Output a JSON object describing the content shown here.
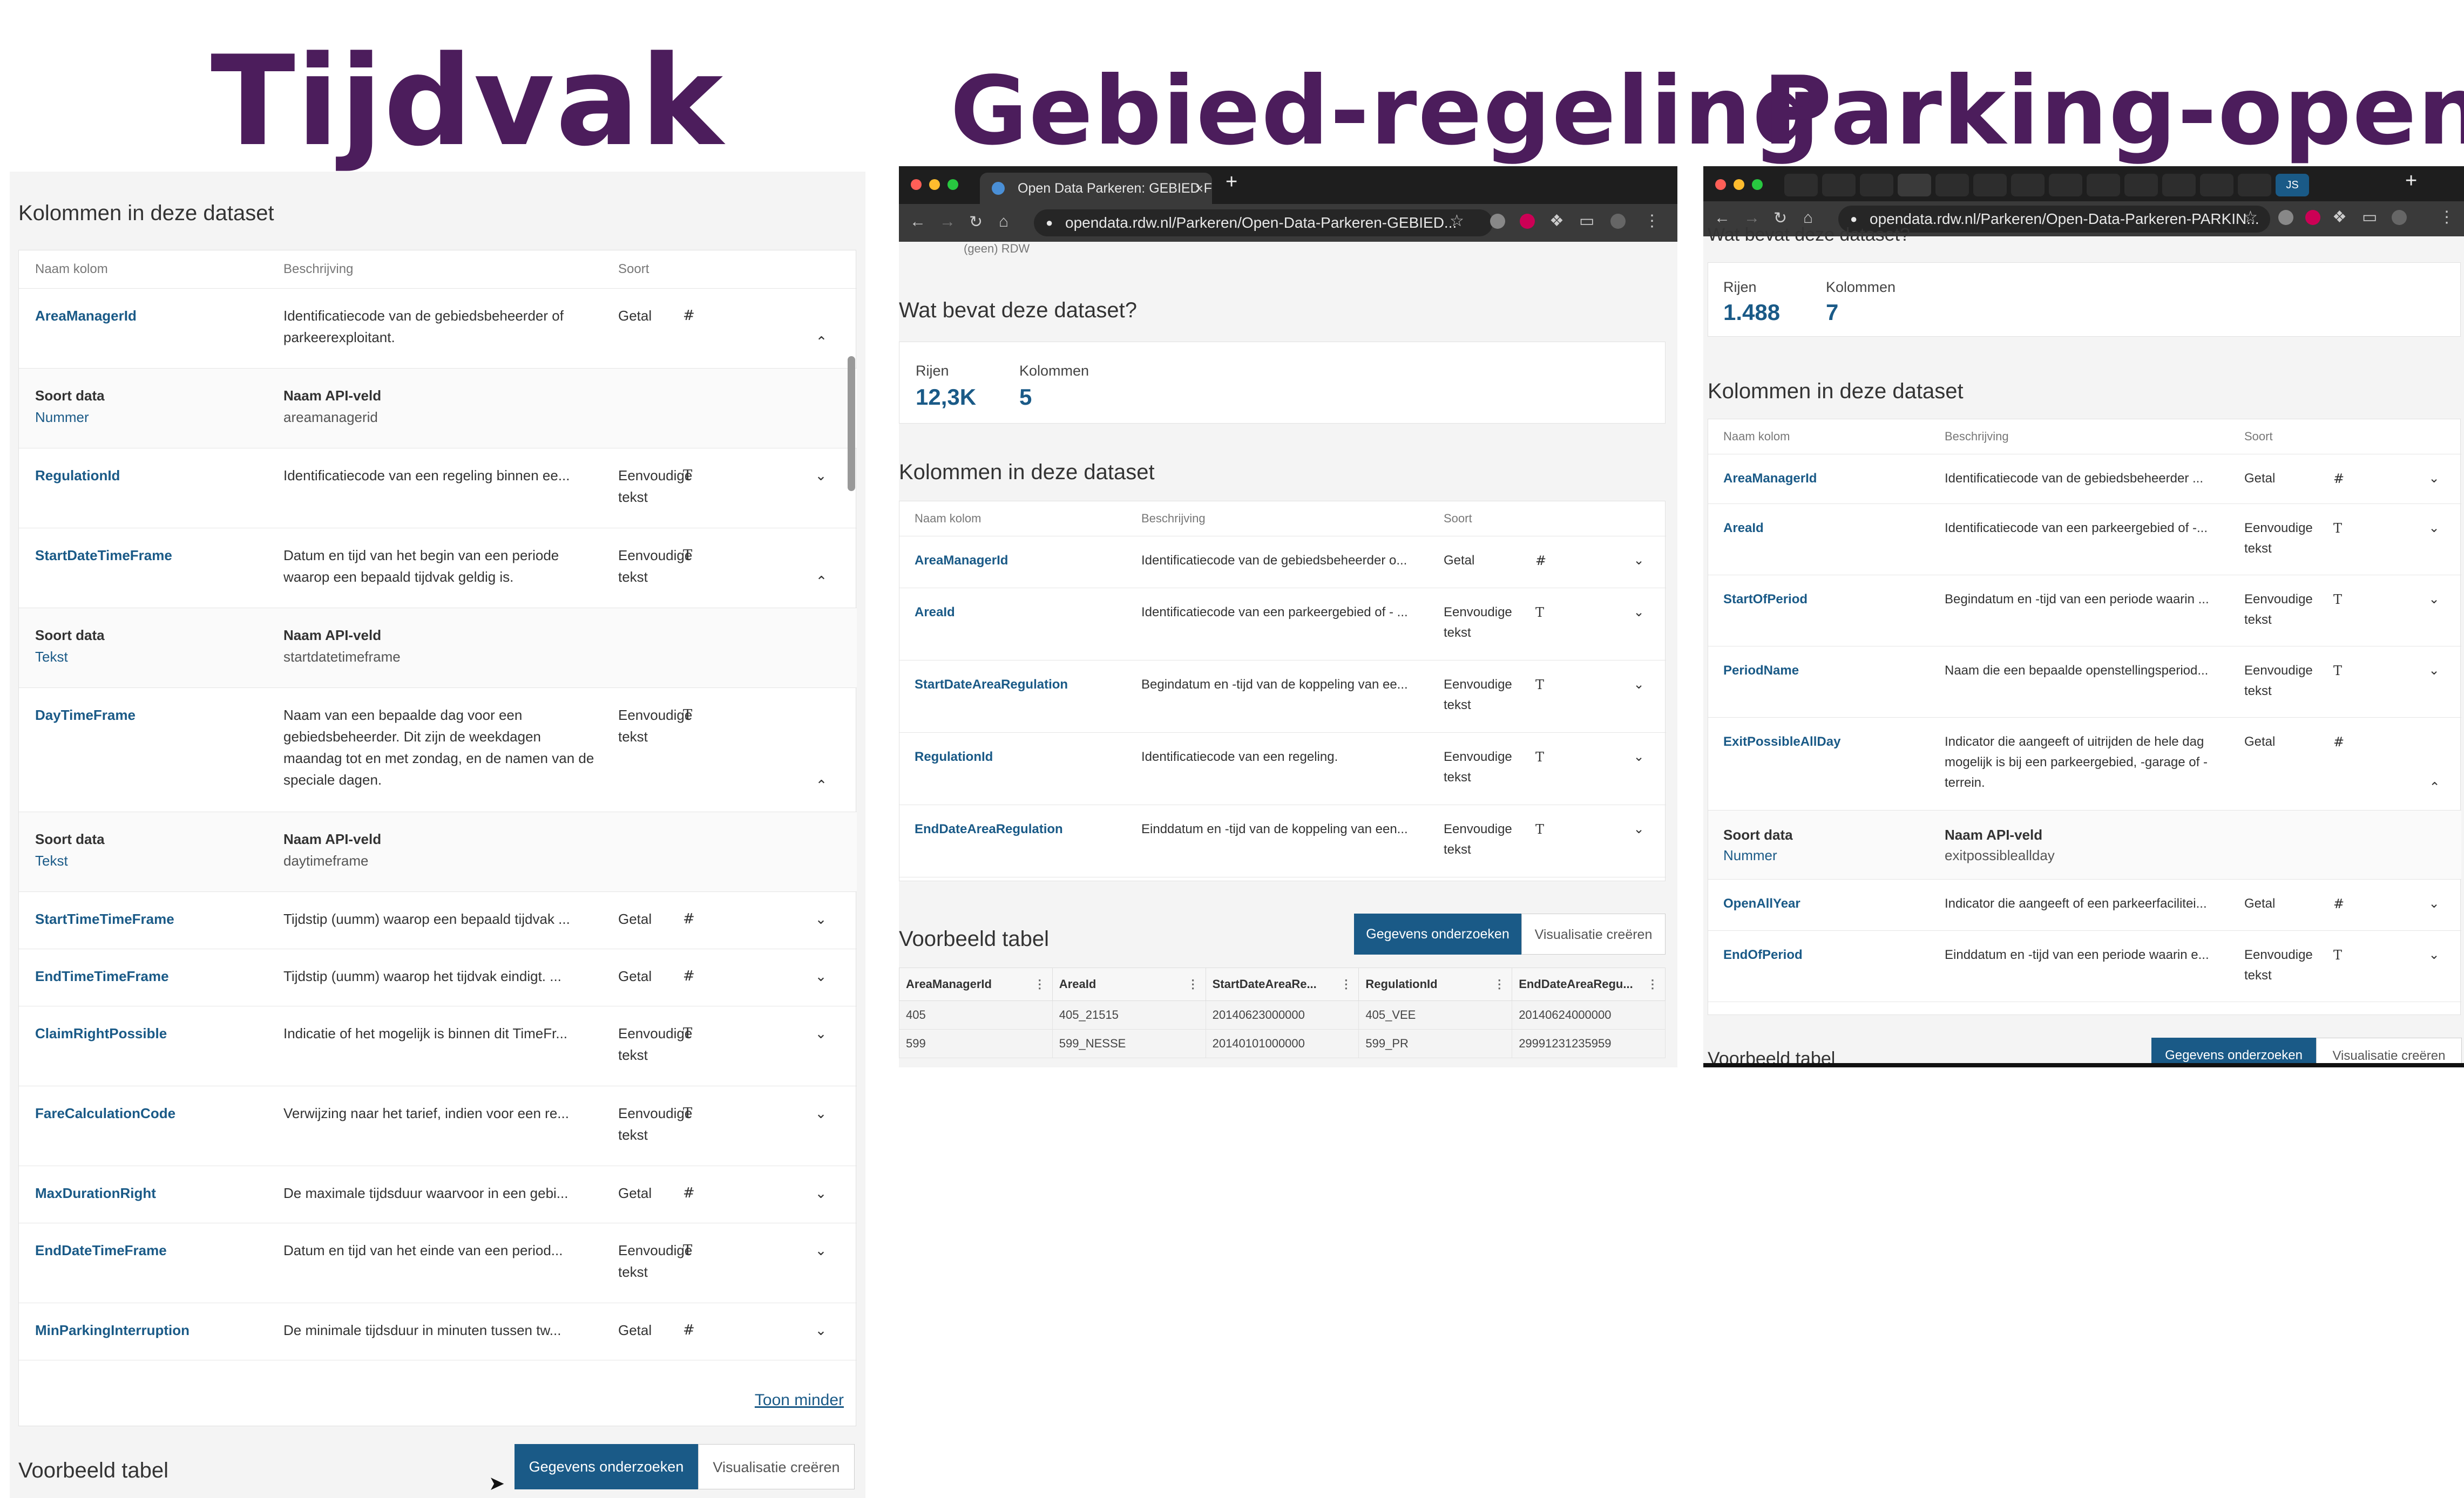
{
  "headings": {
    "t1": "Tijdvak",
    "t2": "Gebied-regeling",
    "t3": "Parking-open"
  },
  "icons": {
    "getal": "#",
    "tekst": "T",
    "chevron": "⌄"
  },
  "colors": {
    "heading": "#4c1d5c",
    "link": "#1a5a87",
    "primary_button": "#1a5a87"
  },
  "tijdvak": {
    "section_title": "Kolommen in deze dataset",
    "columns_header": {
      "name": "Naam kolom",
      "description": "Beschrijving",
      "type": "Soort"
    },
    "rows": [
      {
        "name": "AreaManagerId",
        "description": "Identificatiecode van de gebiedsbeheerder of parkeerexploitant.",
        "type": "Getal",
        "icon": "#"
      },
      {
        "name": "RegulationId",
        "description": "Identificatiecode van een regeling binnen ee...",
        "type": "Eenvoudige tekst",
        "icon": "T"
      },
      {
        "name": "StartDateTimeFrame",
        "description": "Datum en tijd van het begin van een periode waarop een bepaald tijdvak geldig is.",
        "type": "Eenvoudige tekst",
        "icon": "T"
      },
      {
        "name": "DayTimeFrame",
        "description": "Naam van een bepaalde dag voor een gebiedsbeheerder. Dit zijn de weekdagen maandag tot en met zondag, en de namen van de speciale dagen.",
        "type": "Eenvoudige tekst",
        "icon": "T"
      },
      {
        "name": "StartTimeTimeFrame",
        "description": "Tijdstip (uumm) waarop een bepaald tijdvak ...",
        "type": "Getal",
        "icon": "#"
      },
      {
        "name": "EndTimeTimeFrame",
        "description": "Tijdstip (uumm) waarop het tijdvak eindigt. ...",
        "type": "Getal",
        "icon": "#"
      },
      {
        "name": "ClaimRightPossible",
        "description": "Indicatie of het mogelijk is binnen dit TimeFr...",
        "type": "Eenvoudige tekst",
        "icon": "T"
      },
      {
        "name": "FareCalculationCode",
        "description": "Verwijzing naar het tarief, indien voor een re...",
        "type": "Eenvoudige tekst",
        "icon": "T"
      },
      {
        "name": "MaxDurationRight",
        "description": "De maximale tijdsduur waarvoor in een gebi...",
        "type": "Getal",
        "icon": "#"
      },
      {
        "name": "EndDateTimeFrame",
        "description": "Datum en tijd van het einde van een period...",
        "type": "Eenvoudige tekst",
        "icon": "T"
      },
      {
        "name": "MinParkingInterruption",
        "description": "De minimale tijdsduur in minuten tussen tw...",
        "type": "Getal",
        "icon": "#"
      }
    ],
    "details": [
      {
        "label_type": "Soort data",
        "value_type": "Nummer",
        "label_api": "Naam API-veld",
        "value_api": "areamanagerid"
      },
      {
        "label_type": "Soort data",
        "value_type": "Tekst",
        "label_api": "Naam API-veld",
        "value_api": "startdatetimeframe"
      },
      {
        "label_type": "Soort data",
        "value_type": "Tekst",
        "label_api": "Naam API-veld",
        "value_api": "daytimeframe"
      }
    ],
    "toon_minder": "Toon minder",
    "preview_title": "Voorbeeld tabel",
    "btn_primary": "Gegevens onderzoeken",
    "btn_secondary": "Visualisatie creëren"
  },
  "gebied": {
    "tab_title": "Open Data Parkeren: GEBIED F",
    "url": "opendata.rdw.nl/Parkeren/Open-Data-Parkeren-GEBIED...",
    "cut_top": "(geen)   RDW",
    "what_title": "Wat bevat deze dataset?",
    "rows_label": "Rijen",
    "rows_value": "12,3K",
    "cols_label": "Kolommen",
    "cols_value": "5",
    "section_title": "Kolommen in deze dataset",
    "columns_header": {
      "name": "Naam kolom",
      "description": "Beschrijving",
      "type": "Soort"
    },
    "rows": [
      {
        "name": "AreaManagerId",
        "description": "Identificatiecode van de gebiedsbeheerder o...",
        "type": "Getal",
        "icon": "#"
      },
      {
        "name": "AreaId",
        "description": "Identificatiecode van een parkeergebied of - ...",
        "type": "Eenvoudige tekst",
        "icon": "T"
      },
      {
        "name": "StartDateAreaRegulation",
        "description": "Begindatum en -tijd van de koppeling van ee...",
        "type": "Eenvoudige tekst",
        "icon": "T"
      },
      {
        "name": "RegulationId",
        "description": "Identificatiecode van een regeling.",
        "type": "Eenvoudige tekst",
        "icon": "T"
      },
      {
        "name": "EndDateAreaRegulation",
        "description": "Einddatum en -tijd van de koppeling van een...",
        "type": "Eenvoudige tekst",
        "icon": "T"
      }
    ],
    "preview_title": "Voorbeeld tabel",
    "btn_primary": "Gegevens onderzoeken",
    "btn_secondary": "Visualisatie creëren",
    "preview_headers": [
      "AreaManagerId",
      "AreaId",
      "StartDateAreaRe...",
      "RegulationId",
      "EndDateAreaRegu..."
    ],
    "preview_rows": [
      [
        "405",
        "405_21515",
        "20140623000000",
        "405_VEE",
        "20140624000000"
      ],
      [
        "599",
        "599_NESSE",
        "20140101000000",
        "599_PR",
        "29991231235959"
      ]
    ]
  },
  "parking": {
    "url": "opendata.rdw.nl/Parkeren/Open-Data-Parkeren-PARKIN...",
    "avatar": "JS",
    "cut_top": "Wat bevat deze dataset?",
    "rows_label": "Rijen",
    "rows_value": "1.488",
    "cols_label": "Kolommen",
    "cols_value": "7",
    "section_title": "Kolommen in deze dataset",
    "columns_header": {
      "name": "Naam kolom",
      "description": "Beschrijving",
      "type": "Soort"
    },
    "rows": [
      {
        "name": "AreaManagerId",
        "description": "Identificatiecode van de gebiedsbeheerder ...",
        "type": "Getal",
        "icon": "#"
      },
      {
        "name": "AreaId",
        "description": "Identificatiecode van een parkeergebied of -...",
        "type": "Eenvoudige tekst",
        "icon": "T"
      },
      {
        "name": "StartOfPeriod",
        "description": "Begindatum en -tijd van een periode waarin ...",
        "type": "Eenvoudige tekst",
        "icon": "T"
      },
      {
        "name": "PeriodName",
        "description": "Naam die een bepaalde openstellingsperiod...",
        "type": "Eenvoudige tekst",
        "icon": "T"
      },
      {
        "name": "ExitPossibleAllDay",
        "description": "Indicator die aangeeft of uitrijden de hele dag mogelijk is bij een parkeergebied, -garage of -terrein.",
        "type": "Getal",
        "icon": "#"
      },
      {
        "name": "OpenAllYear",
        "description": "Indicator die aangeeft of een parkeerfacilitei...",
        "type": "Getal",
        "icon": "#"
      },
      {
        "name": "EndOfPeriod",
        "description": "Einddatum en -tijd van een periode waarin e...",
        "type": "Eenvoudige tekst",
        "icon": "T"
      }
    ],
    "detail": {
      "label_type": "Soort data",
      "value_type": "Nummer",
      "label_api": "Naam API-veld",
      "value_api": "exitpossiblealldaу"
    },
    "preview_title": "Voorbeeld tabel",
    "btn_primary": "Gegevens onderzoeken",
    "btn_secondary": "Visualisatie creëren"
  }
}
